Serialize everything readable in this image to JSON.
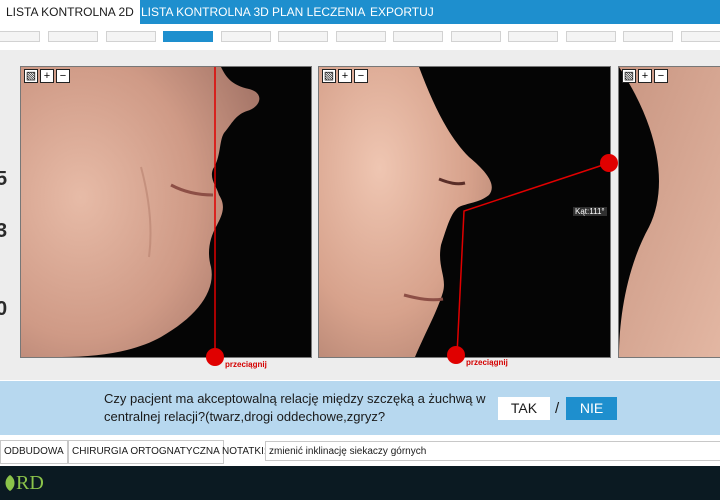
{
  "tabs": [
    {
      "label": "LISTA KONTROLNA 2D",
      "active": true
    },
    {
      "label": "LISTA KONTROLNA 3D",
      "active": false
    },
    {
      "label": "PLAN LECZENIA",
      "active": false
    },
    {
      "label": "EXPORTUJ",
      "active": false
    }
  ],
  "progress": {
    "active_step": 4,
    "total_visible_steps": 13
  },
  "side_numbers": [
    "5",
    "3",
    "0"
  ],
  "panels": {
    "tools": [
      "lock-icon",
      "plus-icon",
      "minus-icon"
    ],
    "drag_label": "przeciągnij",
    "angle_label": "Kąt:111°",
    "line_color": "#e00000"
  },
  "question": {
    "text": "Czy pacjent ma akceptowalną relację między szczęką a żuchwą w centralnej relacji?(twarz,drogi oddechowe,zgryz?",
    "yes_label": "TAK",
    "separator": "/",
    "no_label": "NIE"
  },
  "bottom": {
    "chips": [
      "ODBUDOWA",
      "CHIRURGIA ORTOGNATYCZNA"
    ],
    "notes_label": "NOTATKI:",
    "notes_value": "zmienić inklinację siekaczy górnych"
  },
  "footer": {
    "logo_fragment": "RD"
  },
  "colors": {
    "accent": "#1e8fce",
    "question_bg": "#b7d8ef",
    "marker": "#e00000"
  }
}
